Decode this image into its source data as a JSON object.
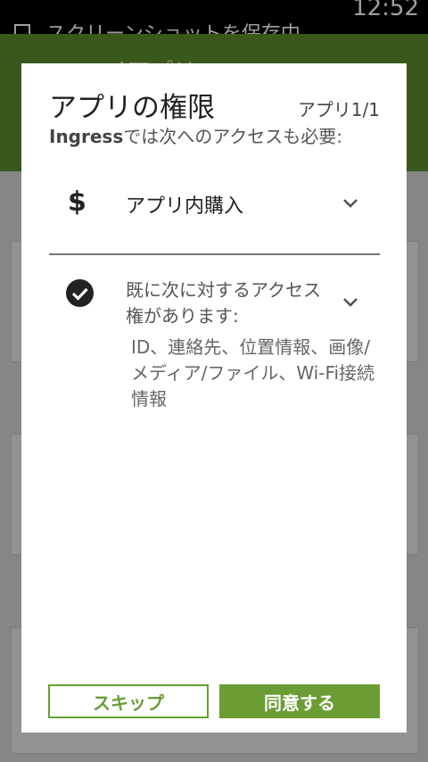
{
  "status_bar": {
    "time": "12:52",
    "notification": "スクリーンショットを保存中..."
  },
  "background": {
    "app_title": "マイアプリ"
  },
  "dialog": {
    "title": "アプリの権限",
    "counter": "アプリ1/1",
    "subtitle_app": "Ingress",
    "subtitle_rest": "では次へのアクセスも必要:",
    "permissions": [
      {
        "icon": "dollar-icon",
        "label": "アプリ内購入"
      },
      {
        "icon": "check-circle-icon",
        "label": "既に次に対するアクセス権があります:",
        "detail": "ID、連絡先、位置情報、画像/メディア/ファイル、Wi-Fi接続情報"
      }
    ],
    "skip_label": "スキップ",
    "agree_label": "同意する"
  },
  "colors": {
    "accent": "#6b9d34",
    "appbar": "#5e8d2e"
  }
}
